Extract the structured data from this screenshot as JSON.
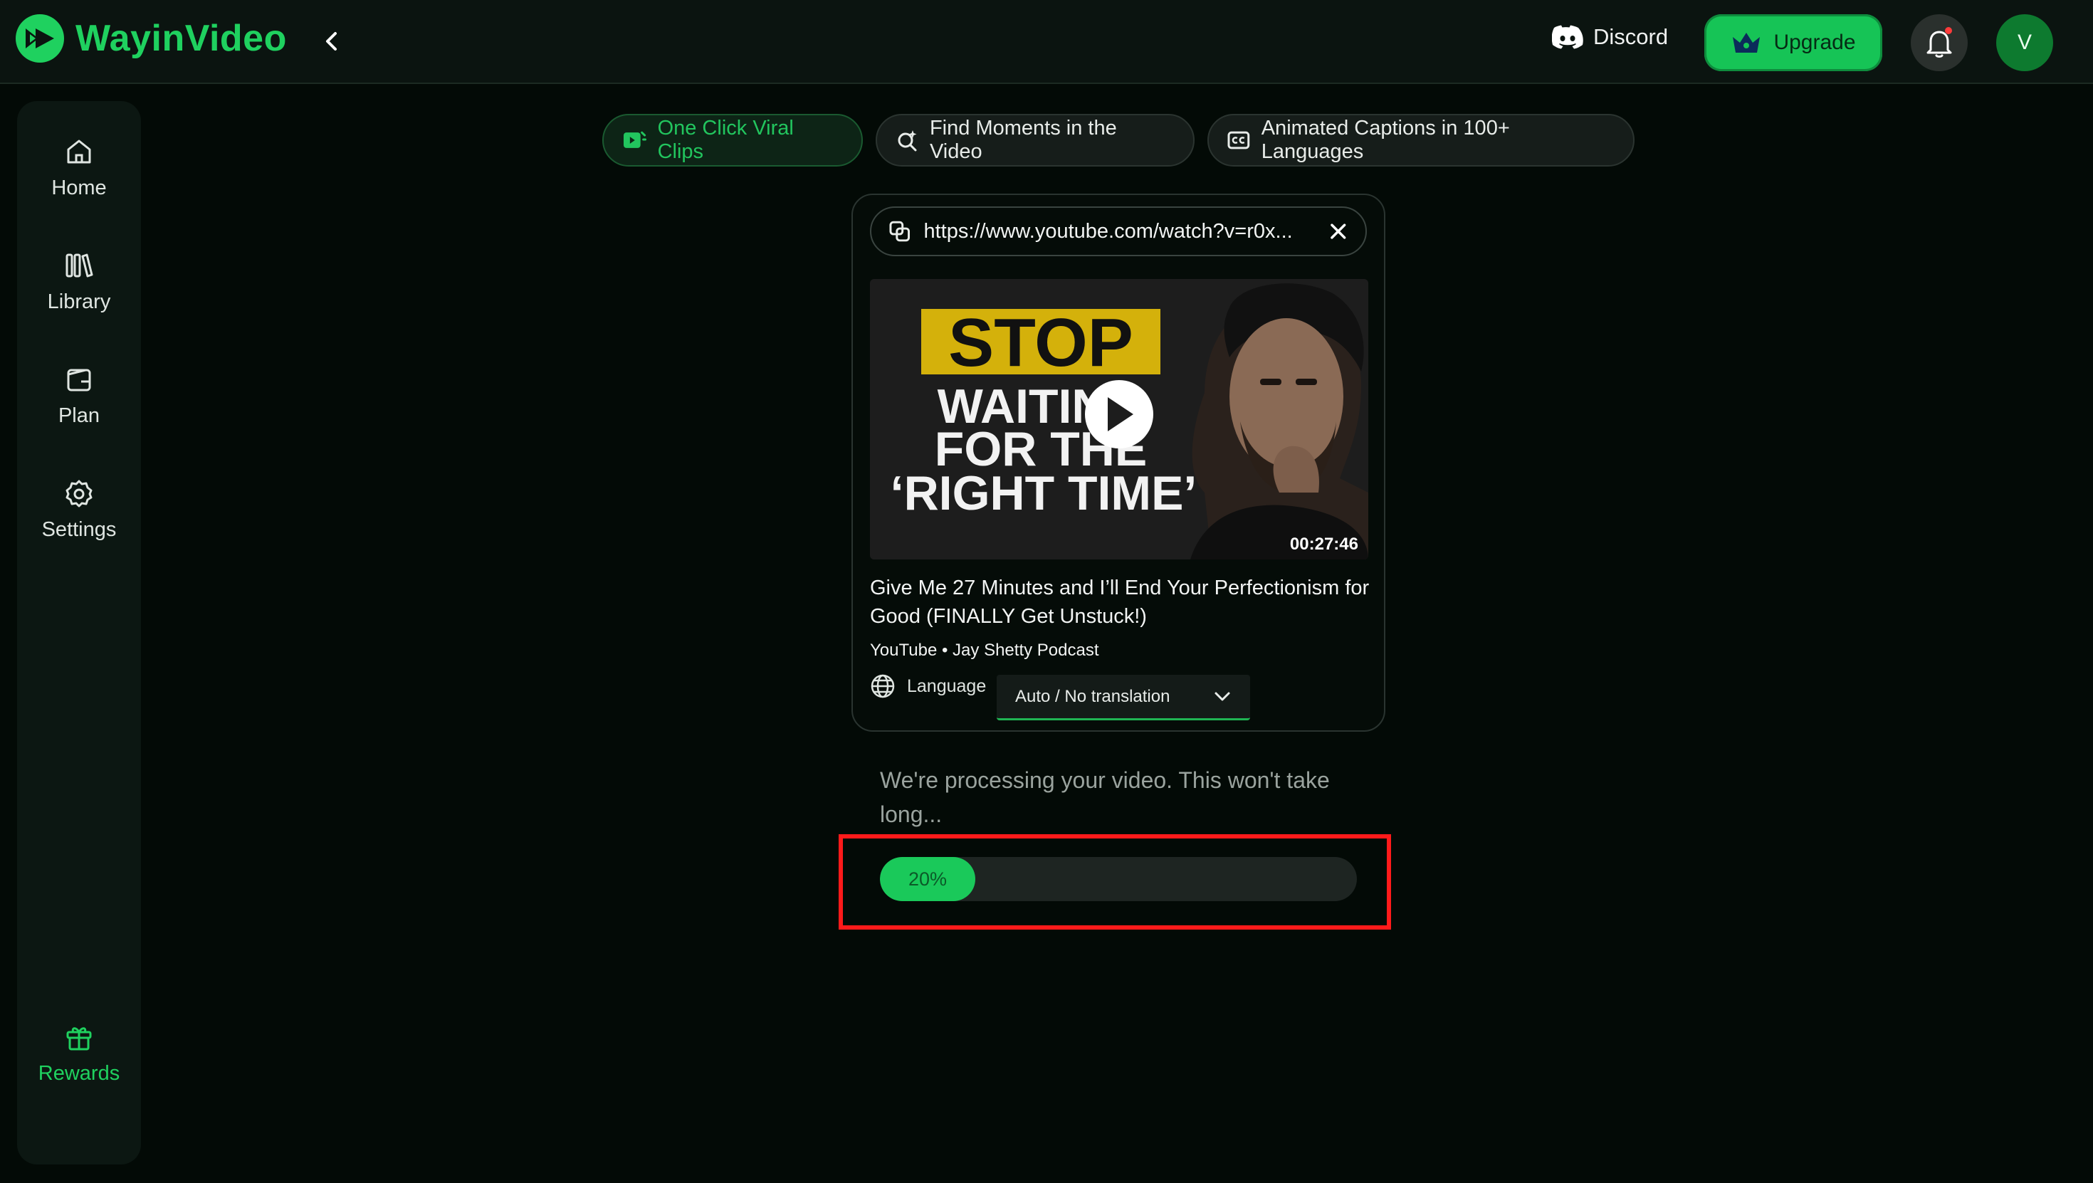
{
  "app": {
    "name": "WayinVideo",
    "brand_color": "#1fd15f"
  },
  "header": {
    "discord_label": "Discord",
    "upgrade_label": "Upgrade",
    "avatar_initial": "V",
    "icons": [
      "discord-icon",
      "crown-icon",
      "bell-icon",
      "chevron-left-icon"
    ]
  },
  "sidebar": {
    "items": [
      {
        "label": "Home",
        "icon": "home-icon"
      },
      {
        "label": "Library",
        "icon": "library-icon"
      },
      {
        "label": "Plan",
        "icon": "wallet-icon"
      },
      {
        "label": "Settings",
        "icon": "gear-icon"
      }
    ],
    "rewards": {
      "label": "Rewards",
      "icon": "gift-icon"
    }
  },
  "tabs": [
    {
      "label": "One Click Viral Clips",
      "active": true,
      "icon": "clip-icon"
    },
    {
      "label": "Find Moments in the Video",
      "active": false,
      "icon": "sparkle-search-icon"
    },
    {
      "label": "Animated Captions in 100+ Languages",
      "active": false,
      "icon": "cc-icon"
    }
  ],
  "video": {
    "url": "https://www.youtube.com/watch?v=r0x...",
    "thumbnail_text": {
      "line1": "STOP",
      "line2": "WAITING",
      "line3": "FOR THE",
      "line4": "‘RIGHT TIME’"
    },
    "duration": "00:27:46",
    "title": "Give Me 27 Minutes and I’ll End Your Perfectionism for Good (FINALLY Get Unstuck!)",
    "meta": "YouTube • Jay Shetty Podcast",
    "language_label": "Language",
    "language_value": "Auto / No translation"
  },
  "processing": {
    "message": "We're processing your video. This won't take long...",
    "progress": 0.2,
    "progress_label": "20%",
    "highlight_color": "#ff1a1a"
  }
}
